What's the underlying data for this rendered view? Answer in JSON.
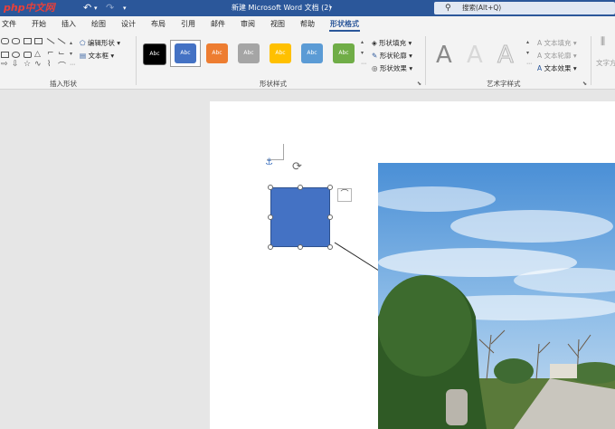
{
  "logo": {
    "text": "php中文网"
  },
  "titlebar": {
    "title": "新建 Microsoft Word 文档 (2)",
    "search_placeholder": "搜索(Alt+Q)"
  },
  "tabs": [
    "文件",
    "开始",
    "插入",
    "绘图",
    "设计",
    "布局",
    "引用",
    "邮件",
    "审阅",
    "视图",
    "帮助",
    "形状格式"
  ],
  "active_tab": "形状格式",
  "ribbon": {
    "insert_shapes": {
      "label": "插入形状",
      "edit_shape": "编辑形状",
      "text_box": "文本框"
    },
    "shape_styles": {
      "label": "形状样式",
      "swatches": [
        {
          "text": "Abc",
          "color": "#000000"
        },
        {
          "text": "Abc",
          "color": "#4472c4"
        },
        {
          "text": "Abc",
          "color": "#ed7d31"
        },
        {
          "text": "Abc",
          "color": "#a5a5a5"
        },
        {
          "text": "Abc",
          "color": "#ffc000"
        },
        {
          "text": "Abc",
          "color": "#5b9bd5"
        },
        {
          "text": "Abc",
          "color": "#70ad47"
        }
      ],
      "fill": "形状填充",
      "outline": "形状轮廓",
      "effects": "形状效果"
    },
    "wordart": {
      "label": "艺术字样式",
      "letters": [
        "A",
        "A",
        "A"
      ],
      "text_fill": "文本填充",
      "text_outline": "文本轮廓",
      "text_effects": "文本效果"
    },
    "text_group": {
      "direction": "文字方"
    }
  },
  "colors": {
    "accent": "#2b579a",
    "shape_fill": "#4472c4"
  }
}
